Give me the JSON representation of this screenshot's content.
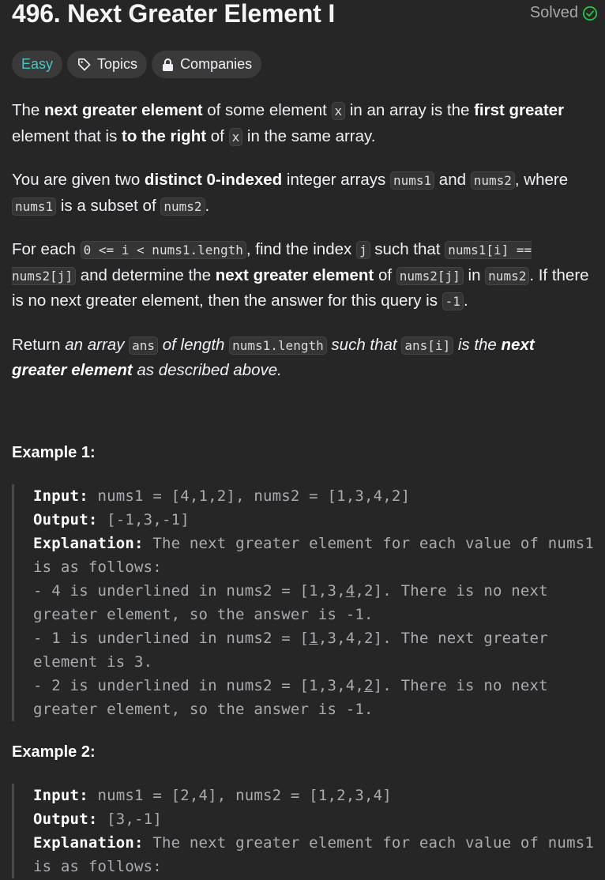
{
  "header": {
    "title": "496. Next Greater Element I",
    "solved_label": "Solved",
    "solved_color": "#28c244"
  },
  "tags": {
    "difficulty": "Easy",
    "topics": "Topics",
    "companies": "Companies"
  },
  "description": {
    "p1": {
      "t1": "The ",
      "b1": "next greater element",
      "t2": " of some element ",
      "c1": "x",
      "t3": " in an array is the ",
      "b2": "first greater",
      "t4": " element that is ",
      "b3": "to the right",
      "t5": " of ",
      "c2": "x",
      "t6": " in the same array."
    },
    "p2": {
      "t1": "You are given two ",
      "b1": "distinct 0-indexed",
      "t2": " integer arrays ",
      "c1": "nums1",
      "t3": " and ",
      "c2": "nums2",
      "t4": ", where ",
      "c3": "nums1",
      "t5": " is a subset of ",
      "c4": "nums2",
      "t6": "."
    },
    "p3": {
      "t1": "For each ",
      "c1": "0 <= i < nums1.length",
      "t2": ", find the index ",
      "c2": "j",
      "t3": " such that ",
      "c3": "nums1[i] == nums2[j]",
      "t4": " and determine the ",
      "b1": "next greater element",
      "t5": " of ",
      "c4": "nums2[j]",
      "t6": " in ",
      "c5": "nums2",
      "t7": ". If there is no next greater element, then the answer for this query is ",
      "c6": "-1",
      "t8": "."
    },
    "p4": {
      "t1": "Return ",
      "i1": "an array",
      "c1": "ans",
      "i2": "of length",
      "c2": "nums1.length",
      "i3": "such that",
      "c3": "ans[i]",
      "i4": "is the",
      "b1": "next greater element",
      "i5": " as described above."
    }
  },
  "example1": {
    "title": "Example 1:",
    "input_label": "Input:",
    "input_value": "nums1 = [4,1,2], nums2 = [1,3,4,2]",
    "output_label": "Output:",
    "output_value": "[-1,3,-1]",
    "explanation_label": "Explanation:",
    "explanation_intro": "The next greater element for each value of nums1 is as follows:",
    "line1_a": "- 4 is underlined in nums2 = [1,3,",
    "line1_u": "4",
    "line1_b": ",2]. There is no next greater element, so the answer is -1.",
    "line2_a": "- 1 is underlined in nums2 = [",
    "line2_u": "1",
    "line2_b": ",3,4,2]. The next greater element is 3.",
    "line3_a": "- 2 is underlined in nums2 = [1,3,4,",
    "line3_u": "2",
    "line3_b": "]. There is no next greater element, so the answer is -1."
  },
  "example2": {
    "title": "Example 2:",
    "input_label": "Input:",
    "input_value": "nums1 = [2,4], nums2 = [1,2,3,4]",
    "output_label": "Output:",
    "output_value": "[3,-1]",
    "explanation_label": "Explanation:",
    "explanation_intro": "The next greater element for each value of nums1 is as follows:"
  }
}
